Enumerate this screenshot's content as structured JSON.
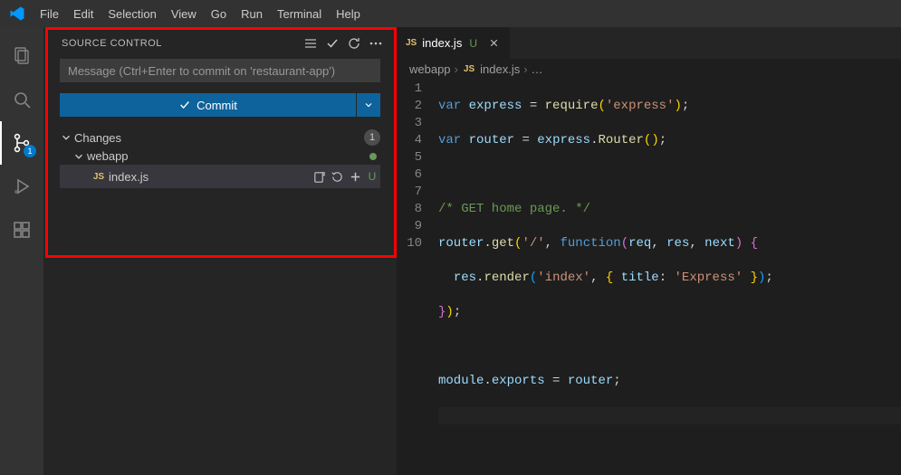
{
  "menubar": {
    "items": [
      "File",
      "Edit",
      "Selection",
      "View",
      "Go",
      "Run",
      "Terminal",
      "Help"
    ]
  },
  "activitybar": {
    "scm_badge": "1"
  },
  "source_control": {
    "title": "SOURCE CONTROL",
    "message_placeholder": "Message (Ctrl+Enter to commit on 'restaurant-app')",
    "commit_label": "Commit",
    "changes_label": "Changes",
    "changes_count": "1",
    "folder": "webapp",
    "file": {
      "icon": "JS",
      "name": "index.js",
      "status": "U"
    }
  },
  "editor": {
    "tab": {
      "icon": "JS",
      "name": "index.js",
      "status": "U"
    },
    "breadcrumbs": {
      "folder": "webapp",
      "icon": "JS",
      "file": "index.js",
      "trail": "…"
    },
    "line_count": 10,
    "code": {
      "l1": {
        "kw1": "var",
        "id1": "express",
        "op": " = ",
        "fn": "require",
        "str": "'express'"
      },
      "l2": {
        "kw1": "var",
        "id1": "router",
        "op": " = ",
        "id2": "express",
        "fn": "Router"
      },
      "l4": {
        "cm": "/* GET home page. */"
      },
      "l5": {
        "id1": "router",
        "fn": "get",
        "str": "'/'",
        "kw": "function",
        "p1": "req",
        "p2": "res",
        "p3": "next"
      },
      "l6": {
        "id1": "res",
        "fn": "render",
        "str1": "'index'",
        "id2": "title",
        "str2": "'Express'"
      },
      "l9": {
        "id1": "module",
        "id2": "exports",
        "op": " = ",
        "id3": "router"
      }
    }
  }
}
